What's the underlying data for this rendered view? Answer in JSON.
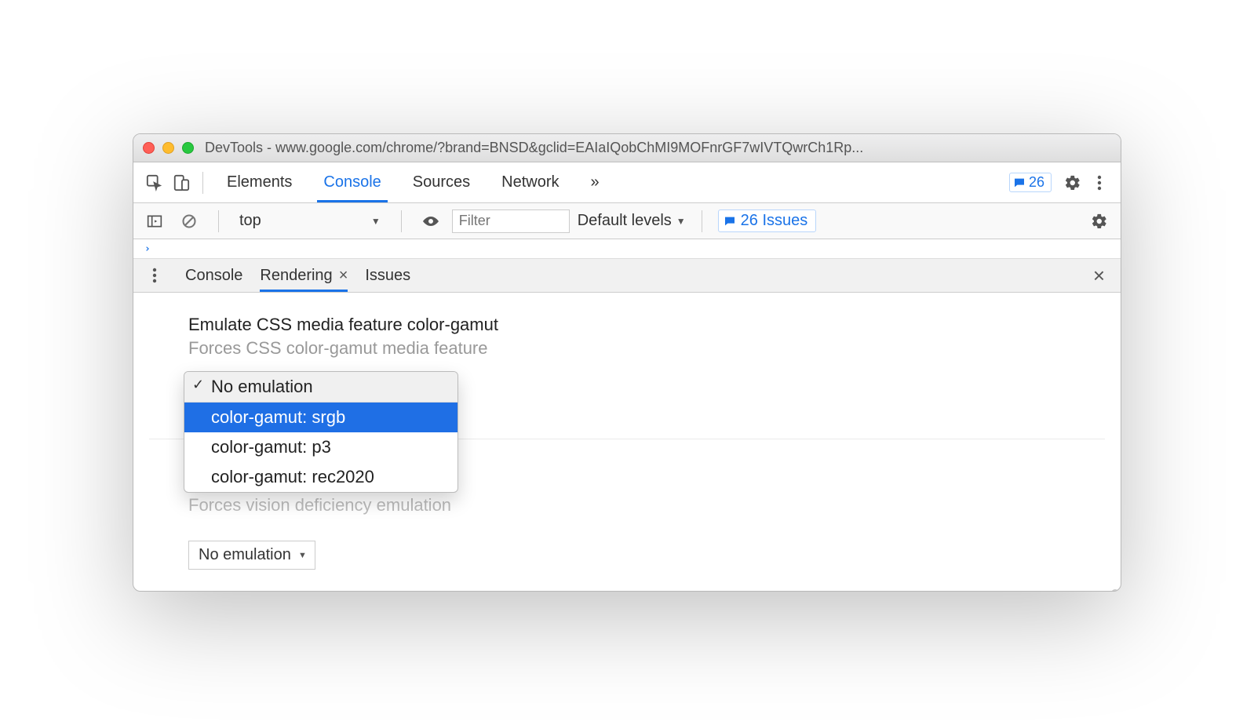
{
  "window": {
    "title": "DevTools - www.google.com/chrome/?brand=BNSD&gclid=EAIaIQobChMI9MOFnrGF7wIVTQwrCh1Rp..."
  },
  "main_tabs": {
    "t0": "Elements",
    "t1": "Console",
    "t2": "Sources",
    "t3": "Network",
    "overflow": "»",
    "issues_count": "26"
  },
  "filterbar": {
    "context": "top",
    "filter_placeholder": "Filter",
    "levels": "Default levels",
    "issues_label": "26 Issues"
  },
  "drawer": {
    "t0": "Console",
    "t1": "Rendering",
    "t2": "Issues"
  },
  "rendering": {
    "title": "Emulate CSS media feature color-gamut",
    "subtitle": "Forces CSS color-gamut media feature",
    "dropdown": {
      "selected": "No emulation",
      "opt0": "color-gamut: srgb",
      "opt1": "color-gamut: p3",
      "opt2": "color-gamut: rec2020"
    },
    "partial_line": "Forces vision deficiency emulation",
    "second_select": "No emulation"
  }
}
